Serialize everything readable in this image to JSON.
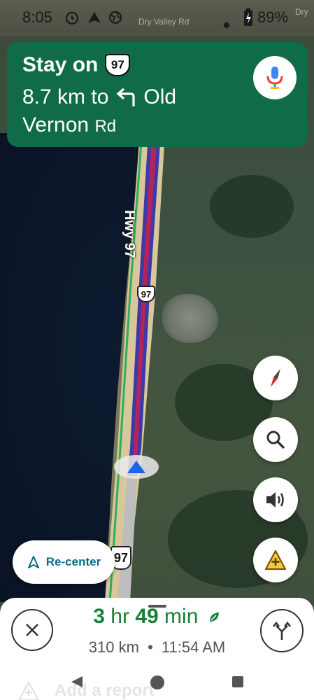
{
  "status_bar": {
    "time": "8:05",
    "battery": "89%",
    "icons": [
      "alarm-icon",
      "navigation-notification-icon",
      "globe-icon",
      "dot-icon",
      "battery-icon"
    ]
  },
  "map": {
    "road_label": "Dry Valley Rd",
    "road_label_right": "Dry",
    "highway_label": "Hwy 97",
    "shield_number_mid": "97",
    "shield_number_low": "97"
  },
  "banner": {
    "line1_prefix": "Stay on",
    "shield_number": "97",
    "distance_text": "8.7 km to",
    "turn_icon": "turn-left-arrow-icon",
    "street_part1": "Old",
    "street_part2": "Vernon",
    "street_suffix": "Rd",
    "mic_icon": "microphone-icon"
  },
  "controls": {
    "compass": "compass-icon",
    "search": "search-icon",
    "sound": "volume-icon",
    "report": "add-report-icon",
    "recenter_label": "Re-center"
  },
  "trip": {
    "eta_hours": "3",
    "eta_hours_unit": "hr",
    "eta_minutes": "49",
    "eta_minutes_unit": "min",
    "distance": "310 km",
    "separator": "•",
    "arrival_time": "11:54 AM"
  },
  "report": {
    "label": "Add a report"
  },
  "colors": {
    "banner_green": "#0f6b48",
    "eta_green": "#188038",
    "route_blue": "#3a3aa8",
    "route_red": "#b3245a",
    "recenter_blue": "#0b6a88"
  }
}
